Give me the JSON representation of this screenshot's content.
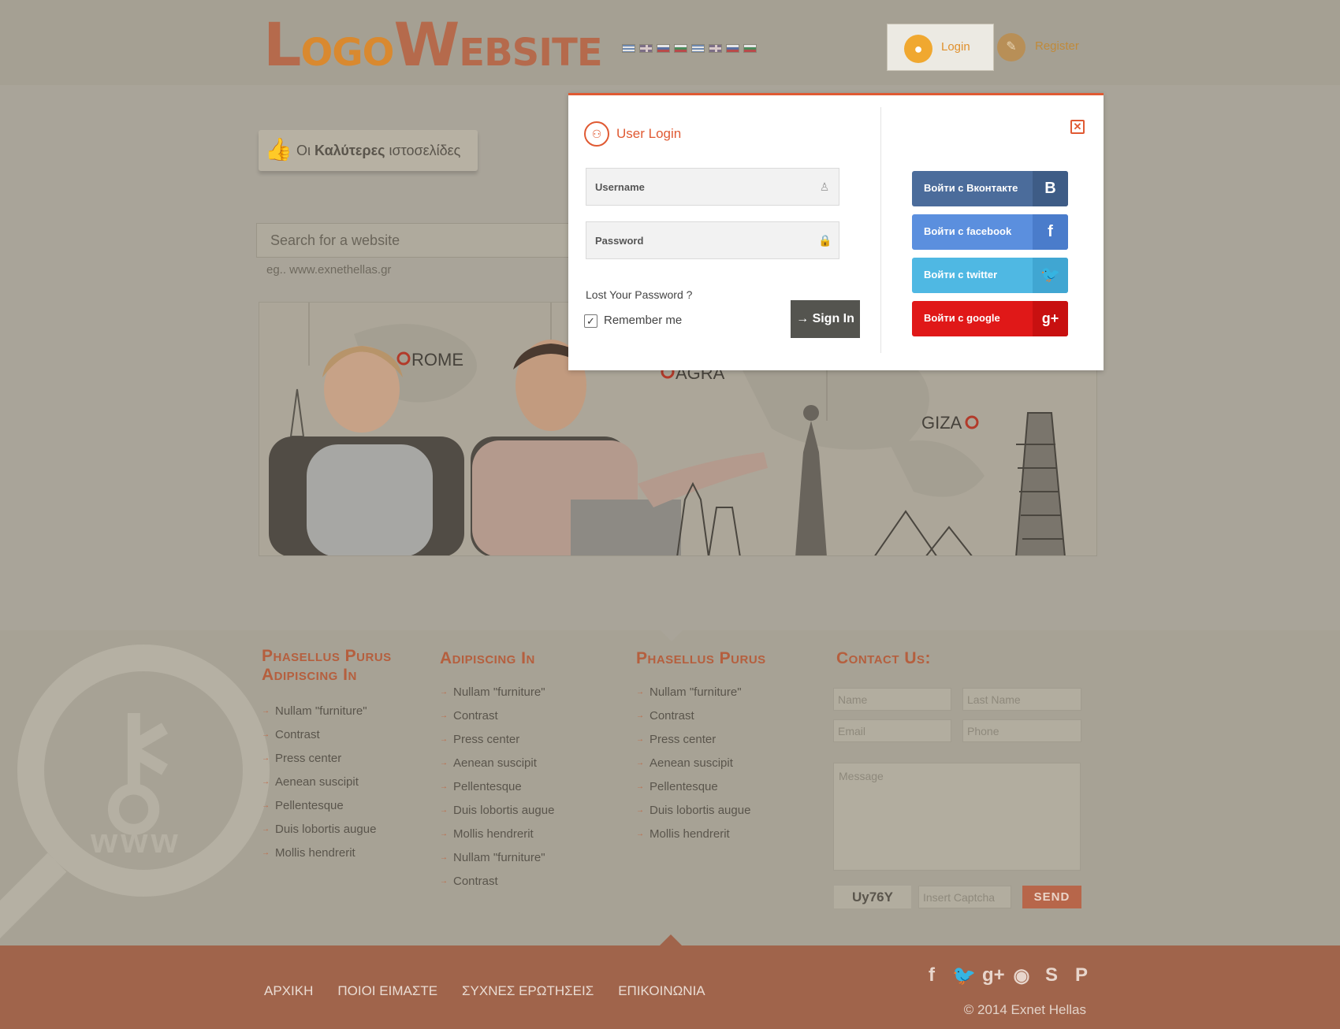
{
  "header": {
    "logo_part1_big": "L",
    "logo_part1_small": "OGO",
    "logo_part2_big": "W",
    "logo_part2_small": "EBSITE",
    "flags": [
      "gr",
      "uk",
      "ru",
      "bg",
      "gr",
      "uk",
      "ru",
      "bg"
    ],
    "login_label": "Login",
    "register_label": "Register",
    "login_icon": "user-icon",
    "register_icon": "pencil-icon"
  },
  "main": {
    "best_prefix": "Οι ",
    "best_bold": "Καλύτερες",
    "best_suffix": " ιστοσελίδες",
    "search_placeholder": "Search for a website",
    "search_hint": "eg.. www.exnethellas.gr",
    "cities": [
      "ROME",
      "AGRA",
      "GIZA"
    ]
  },
  "modal": {
    "title": "User Login",
    "username_placeholder": "Username",
    "password_placeholder": "Password",
    "lost_password": "Lost Your Password ?",
    "remember_me": "Remember me",
    "remember_checked": true,
    "sign_in": "Sign In",
    "socials": [
      {
        "label": "Войти с Вконтакте",
        "icon_char": "B",
        "color": "#4b6c9b",
        "icon_bg": "#3e5c86"
      },
      {
        "label": "Войти с facebook",
        "icon_char": "f",
        "color": "#5b8fde",
        "icon_bg": "#4a7ccb"
      },
      {
        "label": "Войти с twitter",
        "icon_char": "🐦",
        "color": "#4fb8e3",
        "icon_bg": "#40a6d2"
      },
      {
        "label": "Войти с google",
        "icon_char": "g+",
        "color": "#e01818",
        "icon_bg": "#c81010"
      }
    ]
  },
  "footer": {
    "col1_title_line1": "Phasellus Purus",
    "col1_title_line2": "Adipiscing In",
    "col1_items": [
      "Nullam \"furniture\"",
      "Contrast",
      "Press center",
      "Aenean suscipit",
      "Pellentesque",
      "Duis lobortis augue",
      "Mollis hendrerit"
    ],
    "col2_title": "Adipiscing In",
    "col2_items": [
      "Nullam \"furniture\"",
      "Contrast",
      "Press center",
      "Aenean suscipit",
      "Pellentesque",
      "Duis lobortis augue",
      "Mollis hendrerit",
      "Nullam \"furniture\"",
      "Contrast"
    ],
    "col3_title": "Phasellus Purus",
    "col3_items": [
      "Nullam \"furniture\"",
      "Contrast",
      "Press center",
      "Aenean suscipit",
      "Pellentesque",
      "Duis lobortis augue",
      "Mollis hendrerit"
    ],
    "contact_title": "Contact Us:",
    "name_placeholder": "Name",
    "lastname_placeholder": "Last Name",
    "email_placeholder": "Email",
    "phone_placeholder": "Phone",
    "message_placeholder": "Message",
    "captcha_text": "Uy76Y",
    "captcha_placeholder": "Insert Captcha",
    "send_label": "SEND",
    "magnifier_text": "www"
  },
  "bottom": {
    "nav": [
      "ΑΡΧΙΚΗ",
      "ΠΟΙΟΙ ΕΙΜΑΣΤΕ",
      "ΣΥΧΝΕΣ ΕΡΩΤΗΣΕΙΣ",
      "ΕΠΙΚΟΙΝΩΝΙΑ"
    ],
    "socials": [
      {
        "name": "facebook-icon",
        "glyph": "f"
      },
      {
        "name": "twitter-icon",
        "glyph": "🐦"
      },
      {
        "name": "google-plus-icon",
        "glyph": "g+"
      },
      {
        "name": "rss-icon",
        "glyph": "◉"
      },
      {
        "name": "skype-icon",
        "glyph": "S"
      },
      {
        "name": "pinterest-icon",
        "glyph": "P"
      }
    ],
    "copyright": "© 2014 Exnet Hellas"
  }
}
